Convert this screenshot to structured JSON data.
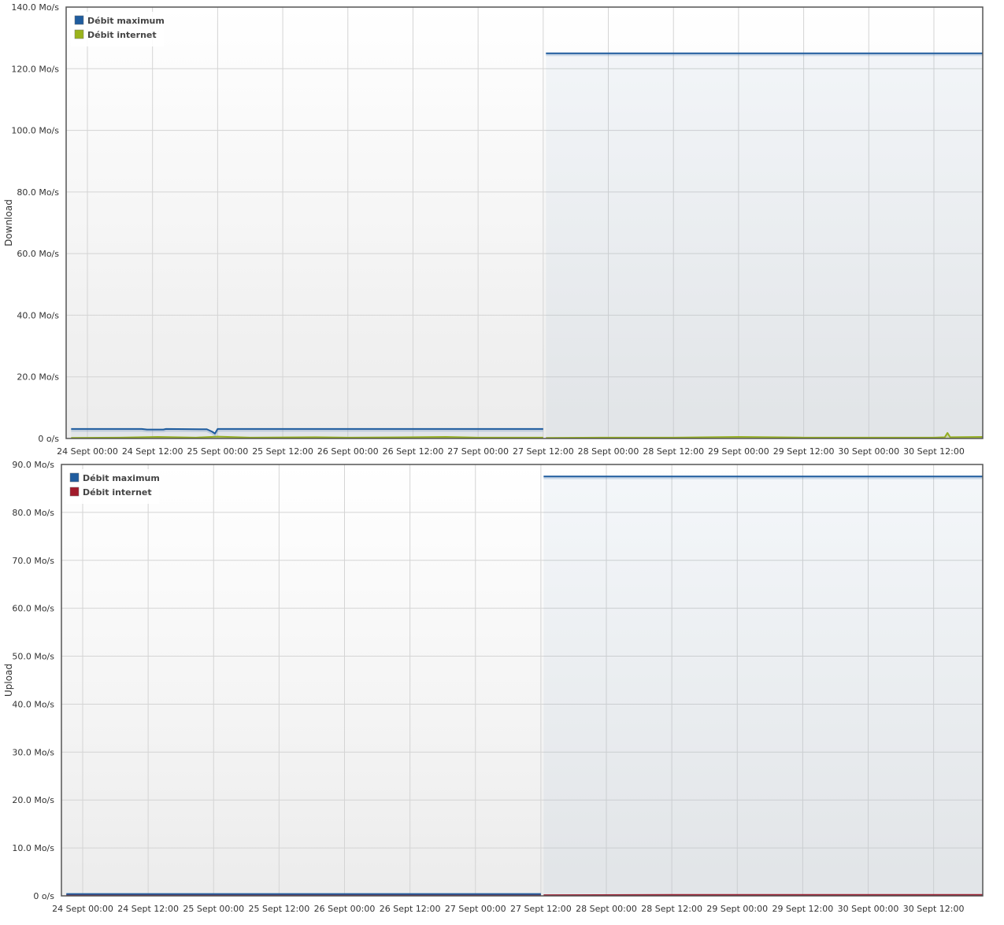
{
  "chart_data": [
    {
      "type": "line",
      "ylabel": "Download",
      "xlabel": "",
      "title": "",
      "ylim": [
        0,
        140
      ],
      "xlim": [
        "24 Sept 00:00",
        "30 Sept 21:00"
      ],
      "y_unit": "Mo/s",
      "y_ticks": [
        {
          "value": 0,
          "label": "0 o/s"
        },
        {
          "value": 20,
          "label": "20.0 Mo/s"
        },
        {
          "value": 40,
          "label": "40.0 Mo/s"
        },
        {
          "value": 60,
          "label": "60.0 Mo/s"
        },
        {
          "value": 80,
          "label": "80.0 Mo/s"
        },
        {
          "value": 100,
          "label": "100.0 Mo/s"
        },
        {
          "value": 120,
          "label": "120.0 Mo/s"
        },
        {
          "value": 140,
          "label": "140.0 Mo/s"
        }
      ],
      "x_ticks": [
        "24 Sept 00:00",
        "24 Sept 12:00",
        "25 Sept 00:00",
        "25 Sept 12:00",
        "26 Sept 00:00",
        "26 Sept 12:00",
        "27 Sept 00:00",
        "27 Sept 12:00",
        "28 Sept 00:00",
        "28 Sept 12:00",
        "29 Sept 00:00",
        "29 Sept 12:00",
        "30 Sept 00:00",
        "30 Sept 12:00"
      ],
      "grid": true,
      "legend_position": "top-left",
      "series": [
        {
          "name": "Débit maximum",
          "color": "#1f5c9e",
          "segments": [
            [
              [
                "23 Sept 21:00",
                3.1
              ],
              [
                "24 Sept 10:00",
                3.1
              ],
              [
                "24 Sept 11:00",
                2.9
              ],
              [
                "24 Sept 14:00",
                2.9
              ],
              [
                "24 Sept 14:30",
                3.1
              ],
              [
                "24 Sept 22:00",
                3.0
              ],
              [
                "24 Sept 23:00",
                2.2
              ],
              [
                "24 Sept 23:30",
                1.6
              ],
              [
                "25 Sept 00:00",
                3.1
              ],
              [
                "27 Sept 12:00",
                3.1
              ]
            ],
            [
              [
                "27 Sept 12:30",
                125
              ],
              [
                "30 Sept 21:00",
                125
              ]
            ]
          ]
        },
        {
          "name": "Débit internet",
          "color": "#9ab31c",
          "segments": [
            [
              [
                "23 Sept 21:00",
                0.2
              ],
              [
                "24 Sept 06:00",
                0.3
              ],
              [
                "24 Sept 13:00",
                0.5
              ],
              [
                "24 Sept 20:00",
                0.3
              ],
              [
                "25 Sept 00:00",
                0.6
              ],
              [
                "25 Sept 06:00",
                0.3
              ],
              [
                "25 Sept 18:00",
                0.4
              ],
              [
                "26 Sept 00:00",
                0.3
              ],
              [
                "26 Sept 12:00",
                0.4
              ],
              [
                "26 Sept 18:00",
                0.5
              ],
              [
                "27 Sept 00:00",
                0.3
              ],
              [
                "27 Sept 12:00",
                0.3
              ]
            ],
            [
              [
                "27 Sept 12:30",
                0.2
              ],
              [
                "28 Sept 00:00",
                0.3
              ],
              [
                "28 Sept 12:00",
                0.3
              ],
              [
                "29 Sept 00:00",
                0.5
              ],
              [
                "29 Sept 12:00",
                0.3
              ],
              [
                "30 Sept 00:00",
                0.3
              ],
              [
                "30 Sept 12:00",
                0.3
              ],
              [
                "30 Sept 14:00",
                0.4
              ],
              [
                "30 Sept 14:30",
                1.8
              ],
              [
                "30 Sept 15:00",
                0.4
              ],
              [
                "30 Sept 21:00",
                0.5
              ]
            ]
          ]
        }
      ]
    },
    {
      "type": "line",
      "ylabel": "Upload",
      "xlabel": "",
      "title": "",
      "ylim": [
        0,
        90
      ],
      "xlim": [
        "24 Sept 00:00",
        "30 Sept 21:00"
      ],
      "y_unit": "Mo/s",
      "y_ticks": [
        {
          "value": 0,
          "label": "0 o/s"
        },
        {
          "value": 10,
          "label": "10.0 Mo/s"
        },
        {
          "value": 20,
          "label": "20.0 Mo/s"
        },
        {
          "value": 30,
          "label": "30.0 Mo/s"
        },
        {
          "value": 40,
          "label": "40.0 Mo/s"
        },
        {
          "value": 50,
          "label": "50.0 Mo/s"
        },
        {
          "value": 60,
          "label": "60.0 Mo/s"
        },
        {
          "value": 70,
          "label": "70.0 Mo/s"
        },
        {
          "value": 80,
          "label": "80.0 Mo/s"
        },
        {
          "value": 90,
          "label": "90.0 Mo/s"
        }
      ],
      "x_ticks": [
        "24 Sept 00:00",
        "24 Sept 12:00",
        "25 Sept 00:00",
        "25 Sept 12:00",
        "26 Sept 00:00",
        "26 Sept 12:00",
        "27 Sept 00:00",
        "27 Sept 12:00",
        "28 Sept 00:00",
        "28 Sept 12:00",
        "29 Sept 00:00",
        "29 Sept 12:00",
        "30 Sept 00:00",
        "30 Sept 12:00"
      ],
      "grid": true,
      "legend_position": "top-left",
      "series": [
        {
          "name": "Débit maximum",
          "color": "#1f5c9e",
          "segments": [
            [
              [
                "23 Sept 21:00",
                0.4
              ],
              [
                "27 Sept 12:00",
                0.4
              ]
            ],
            [
              [
                "27 Sept 12:30",
                87.5
              ],
              [
                "30 Sept 21:00",
                87.5
              ]
            ]
          ]
        },
        {
          "name": "Débit internet",
          "color": "#a11b2b",
          "segments": [
            [
              [
                "23 Sept 21:00",
                0.15
              ],
              [
                "24 Sept 12:00",
                0.2
              ],
              [
                "25 Sept 00:00",
                0.25
              ],
              [
                "26 Sept 00:00",
                0.2
              ],
              [
                "27 Sept 00:00",
                0.2
              ],
              [
                "27 Sept 12:00",
                0.2
              ]
            ],
            [
              [
                "27 Sept 12:30",
                0.15
              ],
              [
                "28 Sept 12:00",
                0.2
              ],
              [
                "29 Sept 12:00",
                0.2
              ],
              [
                "30 Sept 21:00",
                0.2
              ]
            ]
          ]
        }
      ]
    }
  ]
}
